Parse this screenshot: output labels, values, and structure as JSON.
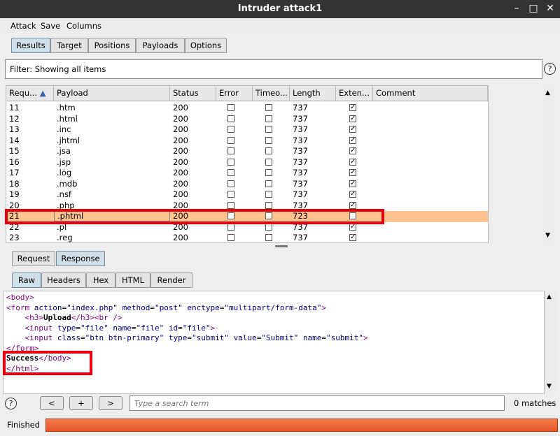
{
  "window": {
    "title": "Intruder attack1",
    "btn_min": "–",
    "btn_max": "□",
    "btn_close": "✕"
  },
  "menu": [
    "Attack",
    "Save",
    "Columns"
  ],
  "top_tabs": [
    "Results",
    "Target",
    "Positions",
    "Payloads",
    "Options"
  ],
  "filter": {
    "text": "Filter: Showing all items"
  },
  "help_glyph": "?",
  "table": {
    "columns": [
      "Requ...",
      "Payload",
      "Status",
      "Error",
      "Timeo...",
      "Length",
      "Exten...",
      "Comment"
    ],
    "sort_arrow": "▲",
    "rows": [
      {
        "req": "11",
        "payload": ".htm",
        "status": "200",
        "error": false,
        "timeout": false,
        "length": "737",
        "ext": true
      },
      {
        "req": "12",
        "payload": ".html",
        "status": "200",
        "error": false,
        "timeout": false,
        "length": "737",
        "ext": true
      },
      {
        "req": "13",
        "payload": ".inc",
        "status": "200",
        "error": false,
        "timeout": false,
        "length": "737",
        "ext": true
      },
      {
        "req": "14",
        "payload": ".jhtml",
        "status": "200",
        "error": false,
        "timeout": false,
        "length": "737",
        "ext": true
      },
      {
        "req": "15",
        "payload": ".jsa",
        "status": "200",
        "error": false,
        "timeout": false,
        "length": "737",
        "ext": true
      },
      {
        "req": "16",
        "payload": ".jsp",
        "status": "200",
        "error": false,
        "timeout": false,
        "length": "737",
        "ext": true
      },
      {
        "req": "17",
        "payload": ".log",
        "status": "200",
        "error": false,
        "timeout": false,
        "length": "737",
        "ext": true
      },
      {
        "req": "18",
        "payload": ".mdb",
        "status": "200",
        "error": false,
        "timeout": false,
        "length": "737",
        "ext": true
      },
      {
        "req": "19",
        "payload": ".nsf",
        "status": "200",
        "error": false,
        "timeout": false,
        "length": "737",
        "ext": true
      },
      {
        "req": "20",
        "payload": ".php",
        "status": "200",
        "error": false,
        "timeout": false,
        "length": "737",
        "ext": true
      },
      {
        "req": "21",
        "payload": ".phtml",
        "status": "200",
        "error": false,
        "timeout": false,
        "length": "723",
        "ext": false,
        "selected": true
      },
      {
        "req": "22",
        "payload": ".pl",
        "status": "200",
        "error": false,
        "timeout": false,
        "length": "737",
        "ext": true
      },
      {
        "req": "23",
        "payload": ".reg",
        "status": "200",
        "error": false,
        "timeout": false,
        "length": "737",
        "ext": true
      }
    ]
  },
  "msg_tabs": [
    "Request",
    "Response"
  ],
  "view_tabs": [
    "Raw",
    "Headers",
    "Hex",
    "HTML",
    "Render"
  ],
  "response_lines": [
    [
      [
        "tag",
        "<body>"
      ]
    ],
    [
      [
        "tag",
        "<form "
      ],
      [
        "attr",
        "action"
      ],
      [
        "plain",
        "="
      ],
      [
        "val",
        "\"index.php\""
      ],
      [
        "plain",
        " "
      ],
      [
        "attr",
        "method"
      ],
      [
        "plain",
        "="
      ],
      [
        "val",
        "\"post\""
      ],
      [
        "plain",
        " "
      ],
      [
        "attr",
        "enctype"
      ],
      [
        "plain",
        "="
      ],
      [
        "val",
        "\"multipart/form-data\""
      ],
      [
        "tag",
        ">"
      ]
    ],
    [
      [
        "plain",
        "    "
      ],
      [
        "tag",
        "<h3>"
      ],
      [
        "bold",
        "Upload"
      ],
      [
        "tag",
        "</h3><br />"
      ]
    ],
    [
      [
        "plain",
        "    "
      ],
      [
        "tag",
        "<input "
      ],
      [
        "attr",
        "type"
      ],
      [
        "plain",
        "="
      ],
      [
        "val",
        "\"file\""
      ],
      [
        "plain",
        " "
      ],
      [
        "attr",
        "name"
      ],
      [
        "plain",
        "="
      ],
      [
        "val",
        "\"file\""
      ],
      [
        "plain",
        " "
      ],
      [
        "attr",
        "id"
      ],
      [
        "plain",
        "="
      ],
      [
        "val",
        "\"file\""
      ],
      [
        "tag",
        ">"
      ]
    ],
    [
      [
        "plain",
        "    "
      ],
      [
        "tag",
        "<input "
      ],
      [
        "attr",
        "class"
      ],
      [
        "plain",
        "="
      ],
      [
        "val",
        "\"btn btn-primary\""
      ],
      [
        "plain",
        " "
      ],
      [
        "attr",
        "type"
      ],
      [
        "plain",
        "="
      ],
      [
        "val",
        "\"submit\""
      ],
      [
        "plain",
        " "
      ],
      [
        "attr",
        "value"
      ],
      [
        "plain",
        "="
      ],
      [
        "val",
        "\"Submit\""
      ],
      [
        "plain",
        " "
      ],
      [
        "attr",
        "name"
      ],
      [
        "plain",
        "="
      ],
      [
        "val",
        "\"submit\""
      ],
      [
        "tag",
        ">"
      ]
    ],
    [
      [
        "tag",
        "</form>"
      ]
    ],
    [
      [
        "bold",
        "Success"
      ],
      [
        "tag",
        "</body>"
      ]
    ],
    [
      [
        "tag",
        "</html>"
      ]
    ]
  ],
  "search": {
    "placeholder": "Type a search term",
    "matches": "0 matches",
    "prev": "<",
    "add": "+",
    "next": ">"
  },
  "status": {
    "text": "Finished",
    "progress": 1.0
  },
  "colors": {
    "highlight_box": "#e8000f",
    "selected_row": "#fdc492",
    "progress": "#f0683a"
  }
}
